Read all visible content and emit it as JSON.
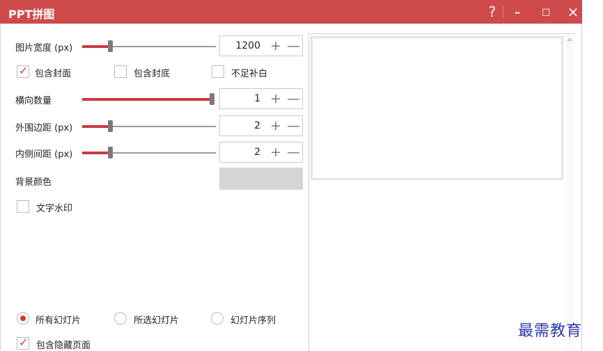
{
  "window": {
    "title": "PPT拼图",
    "help_glyph": "?",
    "minimize_glyph": "–",
    "maximize_glyph": "□",
    "close_glyph": "×"
  },
  "settings": {
    "width": {
      "label": "图片宽度 (px)",
      "value": "1200",
      "slider_fraction": 0.2
    },
    "include_cover": {
      "label": "包含封面",
      "checked": true
    },
    "include_back": {
      "label": "包含封底",
      "checked": false
    },
    "fill_blank": {
      "label": "不足补白",
      "checked": false
    },
    "columns": {
      "label": "横向数量",
      "value": "1",
      "slider_fraction": 1.0
    },
    "outer_margin": {
      "label": "外围边距 (px)",
      "value": "2",
      "slider_fraction": 0.2
    },
    "inner_margin": {
      "label": "内侧间距 (px)",
      "value": "2",
      "slider_fraction": 0.2
    },
    "background": {
      "label": "背景颜色",
      "color": "#d6d6d6"
    },
    "watermark_text": {
      "label": "文字水印",
      "checked": false
    }
  },
  "scope": {
    "all": {
      "label": "所有幻灯片",
      "selected": true
    },
    "selected": {
      "label": "所选幻灯片",
      "selected": false
    },
    "sequence": {
      "label": "幻灯片序列",
      "selected": false
    }
  },
  "include_hidden": {
    "label": "包含隐藏页面",
    "checked": true
  },
  "stepper": {
    "plus": "+",
    "minus": "—"
  },
  "check_glyph": "✓",
  "watermark": "最需教育",
  "colors": {
    "accent": "#cf4b4b",
    "slider_red": "#cf3a3a",
    "watermark": "#2a3aa8"
  }
}
